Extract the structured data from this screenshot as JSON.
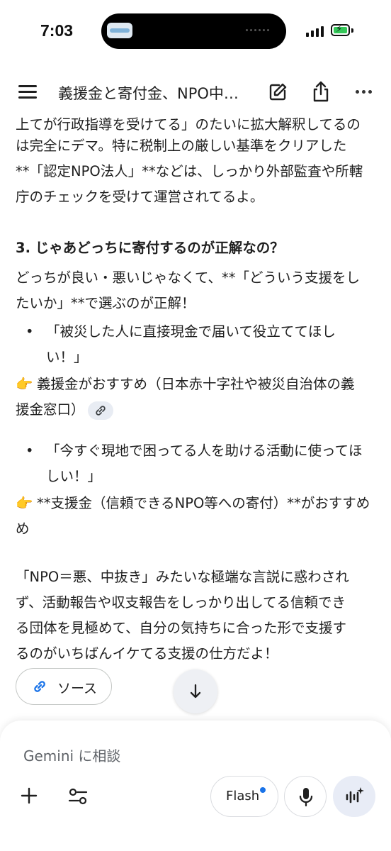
{
  "status_bar": {
    "time": "7:03"
  },
  "header": {
    "title": "義援金と寄付金、NPO中…"
  },
  "content": {
    "clipped_line": "上てが行政指導を受けてる」のたいに拡大解釈してるの",
    "para1": [
      "は完全にデマ。特に税制上の厳しい基準をクリアした",
      "**「認定NPO法人」**などは、しっかり外部監査や所轄",
      "庁のチェックを受けて運営されてるよ。"
    ],
    "heading": "3. じゃあどっちに寄付するのが正解なの？",
    "intro": [
      "どっちが良い・悪いじゃなくて、**「どういう支援をし",
      "たいか」**で選ぶのが正解！"
    ],
    "bullet1": [
      "「被災した人に直接現金で届いて役立ててほし",
      "い！」"
    ],
    "pointer_emoji": "👉",
    "pointer1": [
      "義援金がおすすめ（日本赤十字社や被災自治体の義",
      "援金窓口）"
    ],
    "bullet2": [
      "「今すぐ現地で困ってる人を助ける活動に使ってほ",
      "しい！」"
    ],
    "pointer2": [
      "**支援金（信頼できるNPO等への寄付）**がおすすめ",
      "め"
    ],
    "closing": [
      "「NPO＝悪、中抜き」みたいな極端な言説に惑わされ",
      "ず、活動報告や収支報告をしっかり出してる信頼でき",
      "る団体を見極めて、自分の気持ちに合った形で支援す",
      "るのがいちばんイケてる支援の仕方だよ！"
    ],
    "source_button": "ソース"
  },
  "composer": {
    "placeholder": "Gemini に相談",
    "model_label": "Flash"
  },
  "colors": {
    "link_blue": "#1a73e8",
    "chip_bg": "#e8ecf3",
    "battery_green": "#34c759"
  },
  "icons": [
    "menu-icon",
    "edit-icon",
    "share-icon",
    "more-icon",
    "link-icon",
    "arrow-down-icon",
    "plus-icon",
    "tune-icon",
    "mic-icon",
    "live-icon"
  ]
}
